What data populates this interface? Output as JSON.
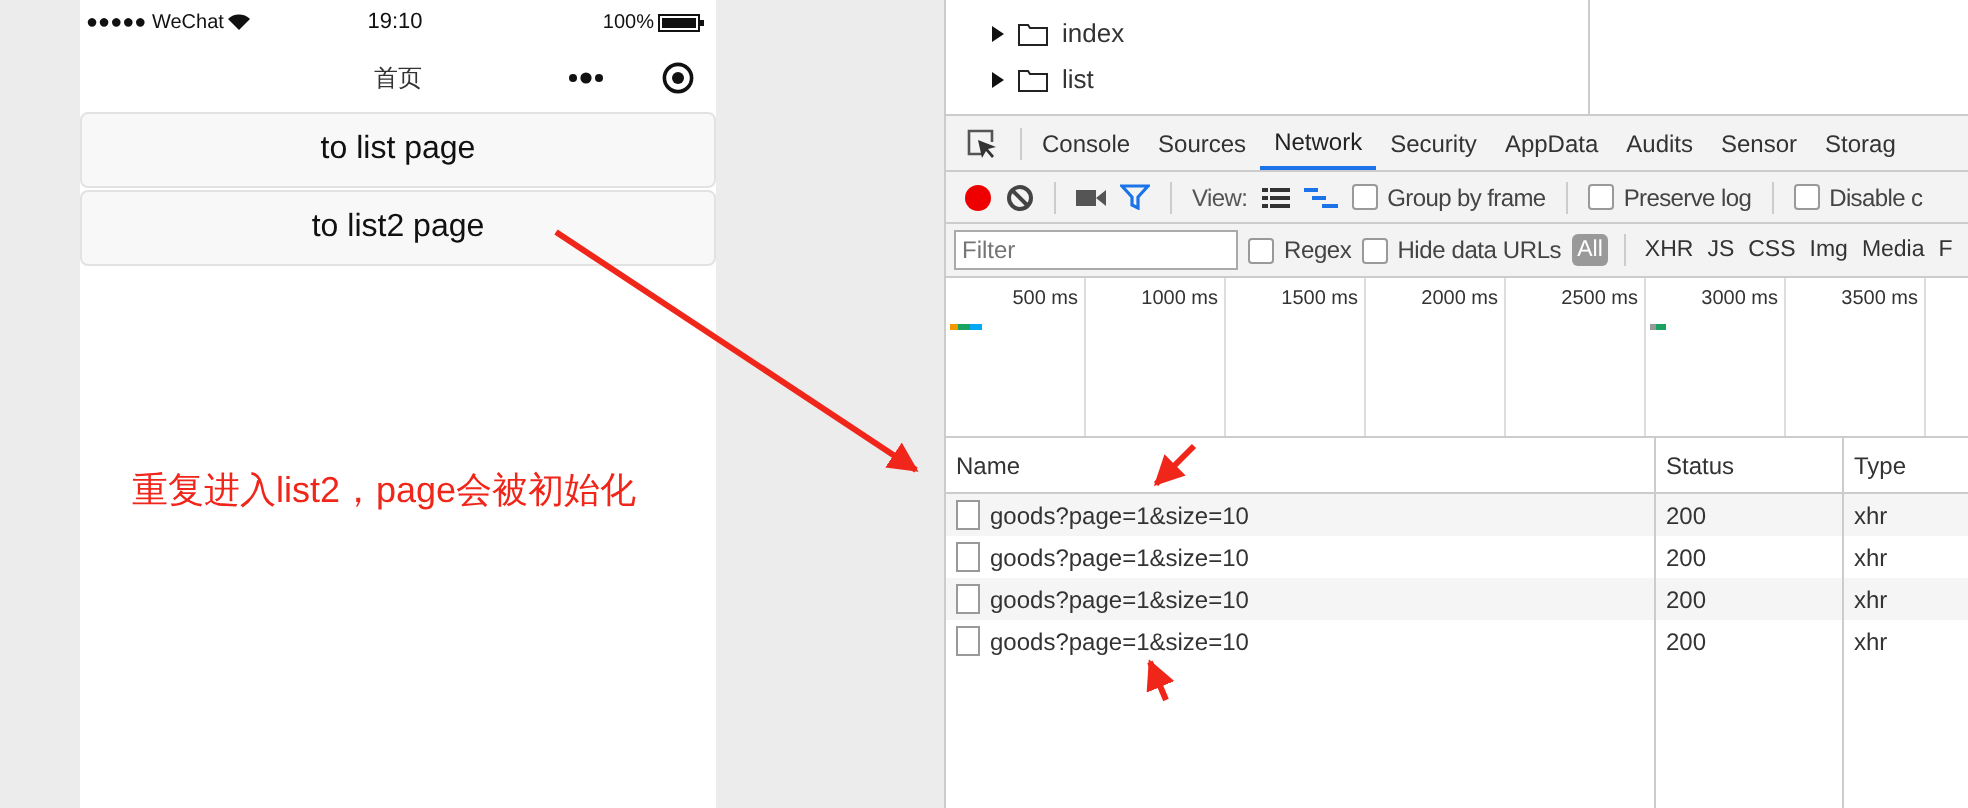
{
  "phone": {
    "status_bar": {
      "carrier": "●●●●● WeChat",
      "time": "19:10",
      "battery": "100%"
    },
    "nav_title": "首页",
    "buttons": [
      "to list page",
      "to list2 page"
    ]
  },
  "annotation": "重复进入list2，page会被初始化",
  "devtools": {
    "file_tree": [
      {
        "label": "index",
        "expanded": false
      },
      {
        "label": "list",
        "expanded": false
      }
    ],
    "tabs": [
      {
        "label": "Console",
        "selected": false
      },
      {
        "label": "Sources",
        "selected": false
      },
      {
        "label": "Network",
        "selected": true
      },
      {
        "label": "Security",
        "selected": false
      },
      {
        "label": "AppData",
        "selected": false
      },
      {
        "label": "Audits",
        "selected": false
      },
      {
        "label": "Sensor",
        "selected": false
      },
      {
        "label": "Storag",
        "selected": false
      }
    ],
    "toolbar": {
      "view_label": "View:",
      "options": [
        {
          "label": "Group by frame",
          "checked": false
        },
        {
          "label": "Preserve log",
          "checked": false
        },
        {
          "label": "Disable c",
          "checked": false
        }
      ]
    },
    "filter": {
      "placeholder": "Filter",
      "options": [
        {
          "label": "Regex",
          "checked": false
        },
        {
          "label": "Hide data URLs",
          "checked": false
        }
      ],
      "types": [
        {
          "label": "All",
          "selected": true
        },
        {
          "label": "XHR",
          "selected": false
        },
        {
          "label": "JS",
          "selected": false
        },
        {
          "label": "CSS",
          "selected": false
        },
        {
          "label": "Img",
          "selected": false
        },
        {
          "label": "Media",
          "selected": false
        },
        {
          "label": "F",
          "selected": false
        }
      ]
    },
    "timeline_ticks": [
      "500 ms",
      "1000 ms",
      "1500 ms",
      "2000 ms",
      "2500 ms",
      "3000 ms",
      "3500 ms"
    ],
    "table": {
      "columns": [
        "Name",
        "Status",
        "Type"
      ],
      "rows": [
        {
          "name": "goods?page=1&size=10",
          "status": "200",
          "type": "xhr"
        },
        {
          "name": "goods?page=1&size=10",
          "status": "200",
          "type": "xhr"
        },
        {
          "name": "goods?page=1&size=10",
          "status": "200",
          "type": "xhr"
        },
        {
          "name": "goods?page=1&size=10",
          "status": "200",
          "type": "xhr"
        }
      ]
    }
  }
}
